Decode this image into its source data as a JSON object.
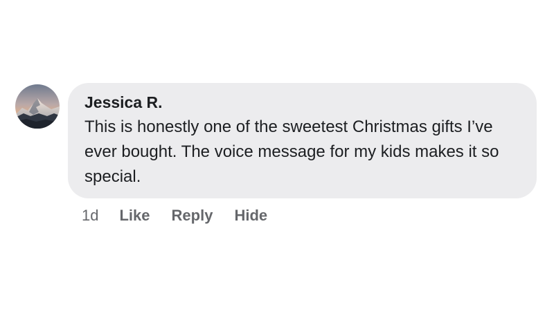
{
  "comment": {
    "author": "Jessica R.",
    "avatar_icon": "mountain-avatar-icon",
    "text": "This is honestly one of the sweetest Christmas gifts I’ve ever bought. The voice message for my kids makes it so special.",
    "timestamp": "1d",
    "actions": {
      "like": "Like",
      "reply": "Reply",
      "hide": "Hide"
    }
  },
  "colors": {
    "bubble_background": "#ececee",
    "text": "#1c1e21",
    "secondary_text": "#65676b"
  }
}
